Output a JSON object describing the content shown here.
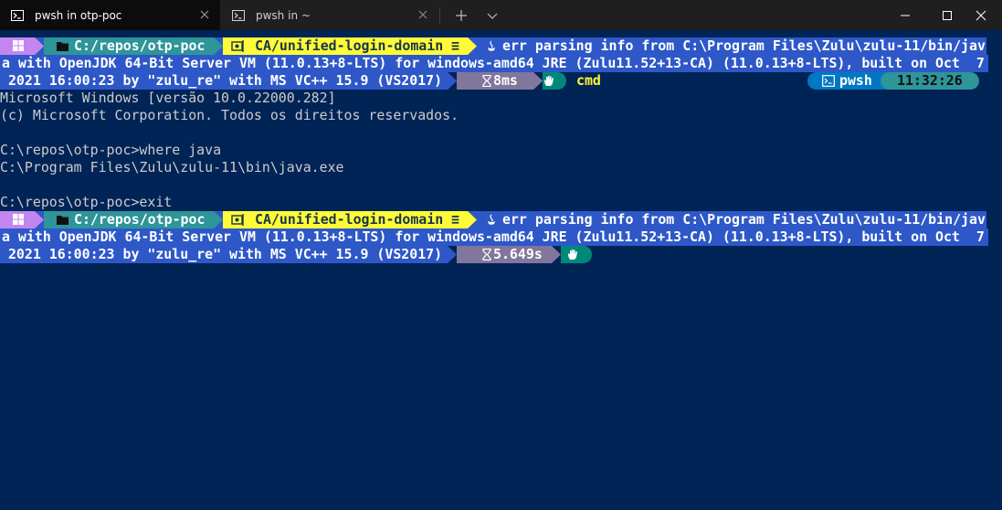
{
  "tabs": [
    {
      "label": "pwsh in otp-poc",
      "active": true
    },
    {
      "label": "pwsh in ~",
      "active": false
    }
  ],
  "icons": {
    "tab_icon": "powershell-icon",
    "close": "close-icon",
    "new_tab": "plus-icon",
    "dropdown": "chevron-down-icon",
    "minimize": "minimize-icon",
    "maximize": "maximize-icon",
    "window_close": "close-icon",
    "os": "windows-icon",
    "folder": "folder-icon",
    "git": "git-icon",
    "java": "java-icon",
    "hourglass": "hourglass-icon",
    "exit_ok": "hand-icon",
    "shell": "terminal-icon"
  },
  "colors": {
    "background": "#012456",
    "os_segment": "#c386f1",
    "path_segment": "#2e9599",
    "git_segment": "#fffb38",
    "java_segment": "#2e58c8",
    "time_segment": "#83769c",
    "status_segment": "#00897b",
    "shell_segment": "#0077c2",
    "clock_segment": "#2e9599"
  },
  "prompt1": {
    "path": "C:/repos/otp-poc",
    "branch": "CA/unified-login-domain ≡",
    "java_line1": "err parsing info from C:\\Program Files\\Zulu\\zulu-11/bin/jav",
    "java_line2": "a with OpenJDK 64-Bit Server VM (11.0.13+8-LTS) for windows-amd64 JRE (Zulu11.52+13-CA) (11.0.13+8-LTS), built on Oct  7",
    "java_line3": " 2021 16:00:23 by \"zulu_re\" with MS VC++ 15.9 (VS2017)",
    "duration": "8ms",
    "command": "cmd",
    "shell": "pwsh",
    "time": "11:32:26"
  },
  "output": [
    "Microsoft Windows [versão 10.0.22000.282]",
    "(c) Microsoft Corporation. Todos os direitos reservados.",
    "",
    "C:\\repos\\otp-poc>where java",
    "C:\\Program Files\\Zulu\\zulu-11\\bin\\java.exe",
    "",
    "C:\\repos\\otp-poc>exit"
  ],
  "prompt2": {
    "path": "C:/repos/otp-poc",
    "branch": "CA/unified-login-domain ≡",
    "java_line1": "err parsing info from C:\\Program Files\\Zulu\\zulu-11/bin/jav",
    "java_line2": "a with OpenJDK 64-Bit Server VM (11.0.13+8-LTS) for windows-amd64 JRE (Zulu11.52+13-CA) (11.0.13+8-LTS), built on Oct  7",
    "java_line3": " 2021 16:00:23 by \"zulu_re\" with MS VC++ 15.9 (VS2017)",
    "duration": "5.649s"
  }
}
